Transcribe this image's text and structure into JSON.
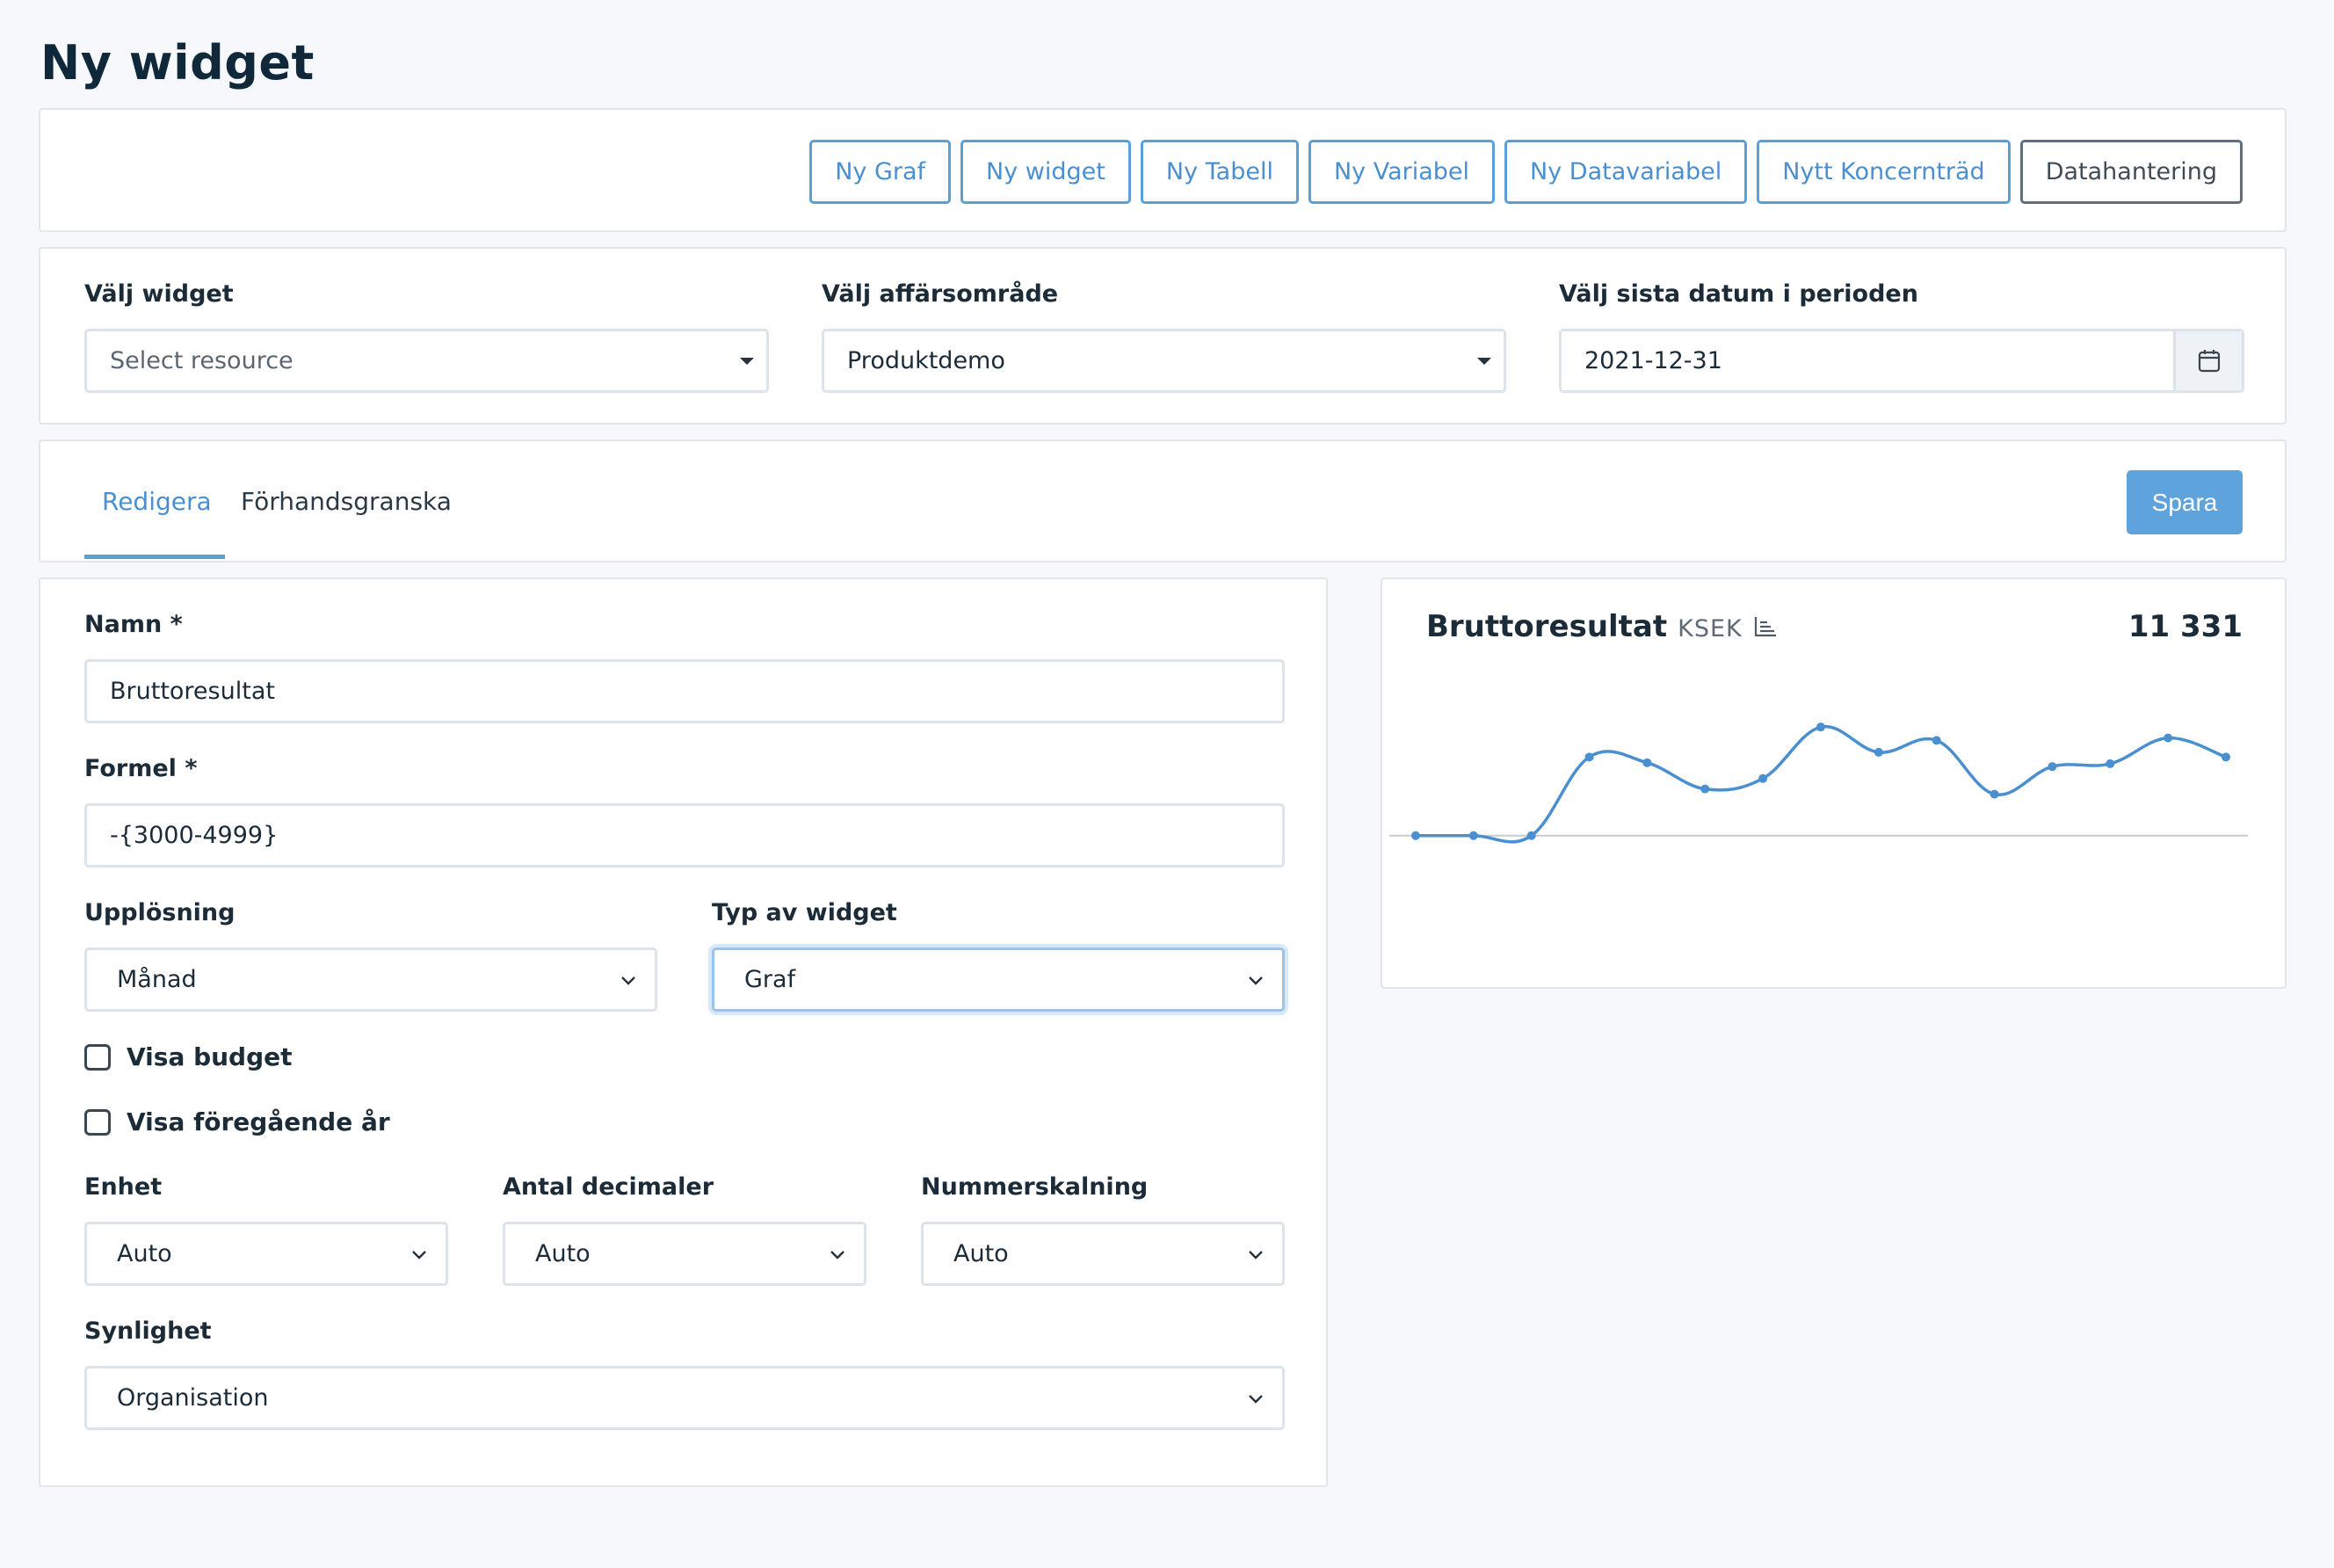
{
  "page": {
    "title": "Ny widget"
  },
  "toolbar": {
    "buttons": [
      "Ny Graf",
      "Ny widget",
      "Ny Tabell",
      "Ny Variabel",
      "Ny Datavariabel",
      "Nytt Koncernträd",
      "Datahantering"
    ]
  },
  "selectors": {
    "widget": {
      "label": "Välj widget",
      "placeholder": "Select resource"
    },
    "area": {
      "label": "Välj affärsområde",
      "value": "Produktdemo"
    },
    "date": {
      "label": "Välj sista datum i perioden",
      "value": "2021-12-31"
    }
  },
  "tabs": {
    "edit": "Redigera",
    "preview": "Förhandsgranska",
    "save": "Spara"
  },
  "form": {
    "name": {
      "label": "Namn *",
      "value": "Bruttoresultat"
    },
    "formula": {
      "label": "Formel *",
      "value": "-{3000-4999}"
    },
    "resolution": {
      "label": "Upplösning",
      "value": "Månad"
    },
    "widget_type": {
      "label": "Typ av widget",
      "value": "Graf"
    },
    "show_budget": {
      "label": "Visa budget",
      "checked": false
    },
    "show_prev_year": {
      "label": "Visa föregående år",
      "checked": false
    },
    "unit": {
      "label": "Enhet",
      "value": "Auto"
    },
    "decimals": {
      "label": "Antal decimaler",
      "value": "Auto"
    },
    "scaling": {
      "label": "Nummerskalning",
      "value": "Auto"
    },
    "visibility": {
      "label": "Synlighet",
      "value": "Organisation"
    }
  },
  "widget_preview": {
    "title": "Bruttoresultat",
    "unit": "KSEK",
    "value": "11 331",
    "line_color": "#4a90d1"
  },
  "chart_data": {
    "type": "line",
    "x": [
      1,
      2,
      3,
      4,
      5,
      6,
      7,
      8,
      9,
      10,
      11,
      12,
      13,
      14,
      15
    ],
    "values": [
      0,
      0,
      0,
      1650,
      1530,
      980,
      1200,
      2280,
      1750,
      2000,
      870,
      1450,
      1510,
      2050,
      1650
    ],
    "ylim": [
      -1850,
      2800
    ],
    "grid": false,
    "legend": "none"
  },
  "colors": {
    "accent": "#4a90d1",
    "accent_button": "#5fa3dc",
    "border": "#dde3ea"
  }
}
